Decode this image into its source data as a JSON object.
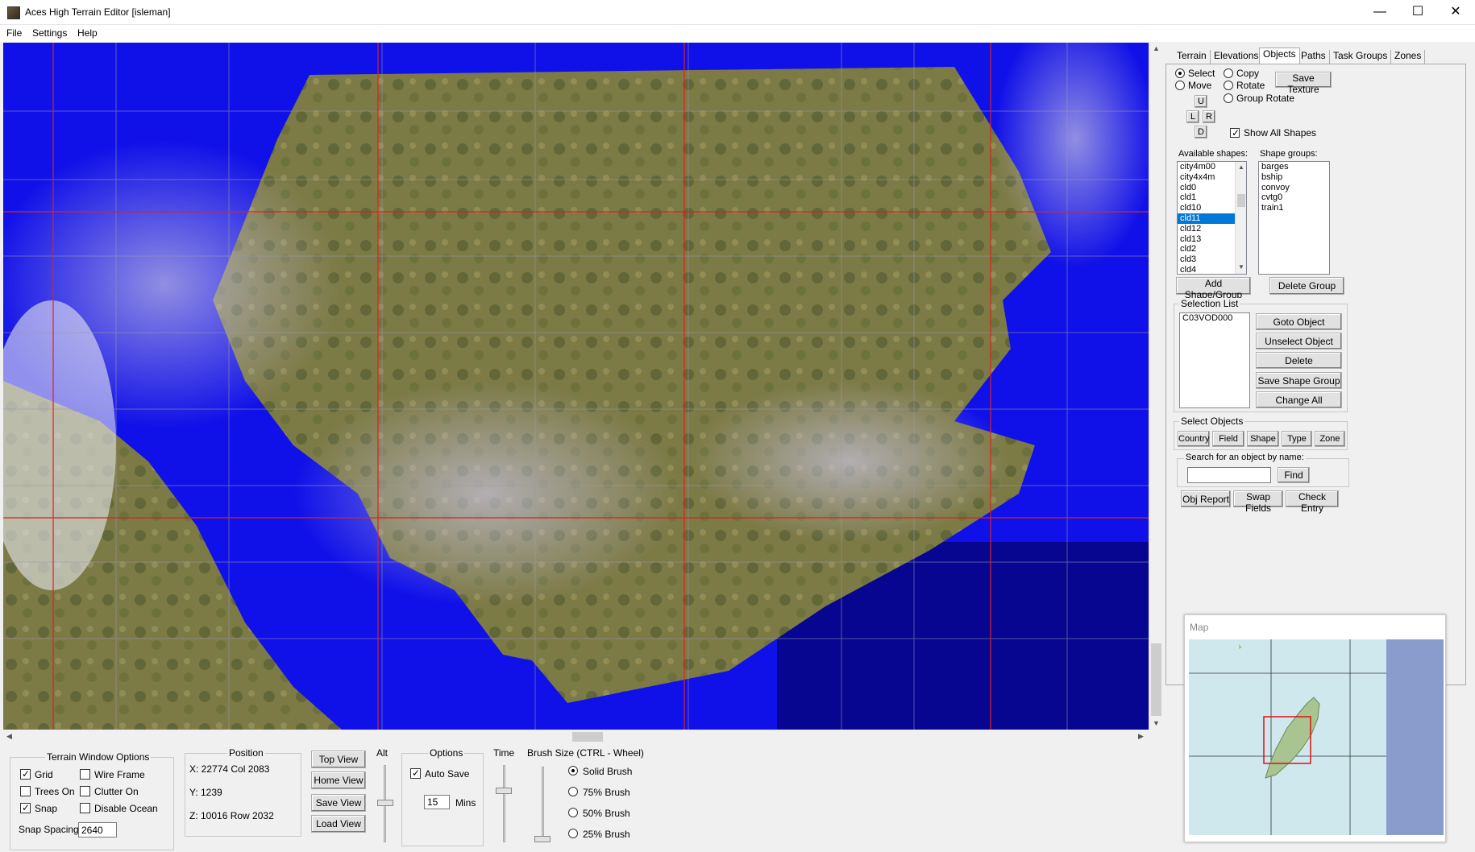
{
  "window": {
    "title": "Aces High Terrain Editor [isleman]",
    "min": "—",
    "max": "☐",
    "close": "✕"
  },
  "menu": [
    "File",
    "Settings",
    "Help"
  ],
  "scroll": {
    "up": "▲",
    "down": "▼",
    "left": "◀",
    "right": "▶"
  },
  "terrain_options": {
    "title": "Terrain Window Options",
    "grid": "Grid",
    "wireframe": "Wire Frame",
    "trees": "Trees On",
    "clutter": "Clutter On",
    "snap": "Snap",
    "disable_ocean": "Disable Ocean",
    "snap_spacing_label": "Snap Spacing",
    "snap_spacing_value": "2640",
    "checked": {
      "grid": true,
      "wireframe": false,
      "trees": false,
      "clutter": false,
      "snap": true,
      "disable_ocean": false
    }
  },
  "position": {
    "title": "Position",
    "x": "X:   22774 Col 2083",
    "y": "Y:   1239",
    "z": "Z:   10016  Row 2032"
  },
  "views": {
    "top": "Top View",
    "home": "Home View",
    "save": "Save View",
    "load": "Load View"
  },
  "alt_label": "Alt",
  "options": {
    "title": "Options",
    "auto_save": "Auto Save",
    "auto_save_checked": true,
    "mins_value": "15",
    "mins_label": "Mins"
  },
  "time_label": "Time",
  "brush": {
    "title": "Brush Size (CTRL - Wheel)",
    "solid": "Solid Brush",
    "b75": "75% Brush",
    "b50": "50% Brush",
    "b25": "25% Brush",
    "selected": "solid"
  },
  "tabs": [
    "Terrain",
    "Elevations",
    "Objects",
    "Paths",
    "Task Groups",
    "Zones"
  ],
  "active_tab": "Objects",
  "objects": {
    "select": "Select",
    "copy": "Copy",
    "move": "Move",
    "rotate": "Rotate",
    "group_rotate": "Group Rotate",
    "save_texture": "Save Texture",
    "u": "U",
    "l": "L",
    "r": "R",
    "d": "D",
    "show_all_shapes": "Show All Shapes",
    "available_label": "Available shapes:",
    "available": [
      "city4m00",
      "city4x4m",
      "cld0",
      "cld1",
      "cld10",
      "cld11",
      "cld12",
      "cld13",
      "cld2",
      "cld3",
      "cld4"
    ],
    "available_selected": "cld11",
    "groups_label": "Shape groups:",
    "groups": [
      "barges",
      "bship",
      "convoy",
      "cvtg0",
      "train1"
    ],
    "add_shape_group": "Add Shape/Group",
    "delete_group": "Delete Group",
    "selection_list_label": "Selection List",
    "selection_list": [
      "C03VOD000"
    ],
    "goto_object": "Goto Object",
    "unselect_object": "Unselect Object",
    "delete": "Delete",
    "save_shape_group": "Save Shape Group",
    "change_all": "Change All",
    "select_objects_label": "Select Objects",
    "select_buttons": [
      "Country",
      "Field",
      "Shape",
      "Type",
      "Zone"
    ],
    "search_label": "Search for an object by name:",
    "search_value": "",
    "find": "Find",
    "obj_report": "Obj Report",
    "swap_fields": "Swap Fields",
    "check_entry": "Check Entry"
  },
  "map_title": "Map"
}
